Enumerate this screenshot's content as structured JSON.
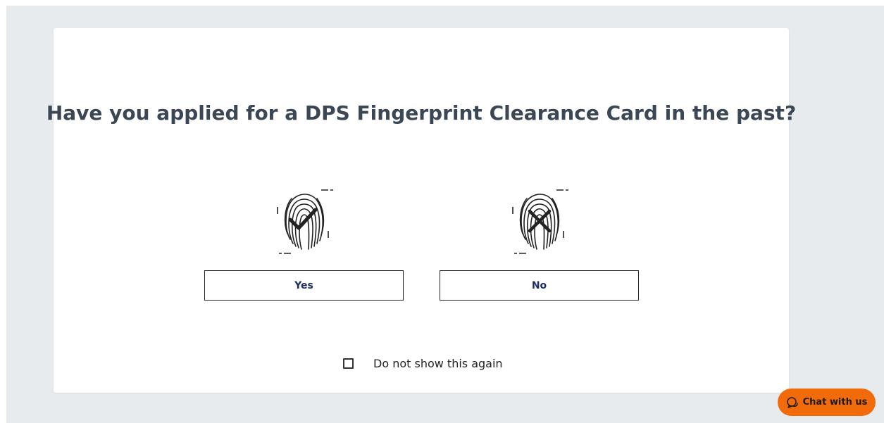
{
  "dialog": {
    "question": "Have you applied for a DPS Fingerprint Clearance Card in the past?",
    "options": [
      {
        "label": "Yes",
        "icon": "fingerprint-check-icon"
      },
      {
        "label": "No",
        "icon": "fingerprint-x-icon"
      }
    ],
    "dont_show_label": "Do not show this again",
    "dont_show_checked": false
  },
  "chat": {
    "label": "Chat with us",
    "icon": "chat-bubble-icon"
  },
  "colors": {
    "background": "#e8ebee",
    "heading": "#3b4754",
    "button_text": "#1a2e63",
    "chat_accent": "#f26b0a"
  }
}
